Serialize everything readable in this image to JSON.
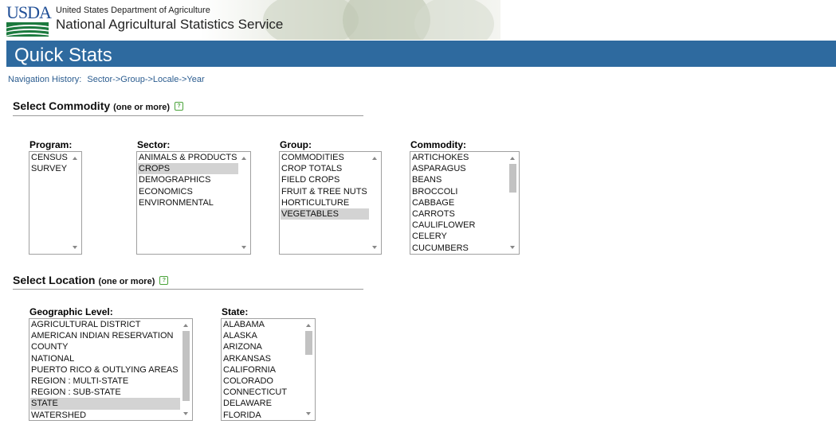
{
  "header": {
    "logo_text": "USDA",
    "org_line1": "United States Department of Agriculture",
    "org_line2": "National Agricultural Statistics Service",
    "page_title": "Quick Stats"
  },
  "nav_history": {
    "label": "Navigation History:",
    "path": "Sector->Group->Locale->Year"
  },
  "commodity_section": {
    "title": "Select Commodity",
    "subtitle": "(one or more)",
    "program": {
      "label": "Program:",
      "options": [
        "CENSUS",
        "SURVEY"
      ],
      "selected": []
    },
    "sector": {
      "label": "Sector:",
      "options": [
        "ANIMALS & PRODUCTS",
        "CROPS",
        "DEMOGRAPHICS",
        "ECONOMICS",
        "ENVIRONMENTAL"
      ],
      "selected": [
        "CROPS"
      ]
    },
    "group": {
      "label": "Group:",
      "options": [
        "COMMODITIES",
        "CROP TOTALS",
        "FIELD CROPS",
        "FRUIT & TREE NUTS",
        "HORTICULTURE",
        "VEGETABLES"
      ],
      "selected": [
        "VEGETABLES"
      ]
    },
    "commodity": {
      "label": "Commodity:",
      "options": [
        "ARTICHOKES",
        "ASPARAGUS",
        "BEANS",
        "BROCCOLI",
        "CABBAGE",
        "CARROTS",
        "CAULIFLOWER",
        "CELERY",
        "CUCUMBERS"
      ],
      "selected": []
    }
  },
  "location_section": {
    "title": "Select Location",
    "subtitle": "(one or more)",
    "geo_level": {
      "label": "Geographic Level:",
      "options": [
        "AGRICULTURAL DISTRICT",
        "AMERICAN INDIAN RESERVATION",
        "COUNTY",
        "NATIONAL",
        "PUERTO RICO & OUTLYING AREAS",
        "REGION : MULTI-STATE",
        "REGION : SUB-STATE",
        "STATE",
        "WATERSHED"
      ],
      "selected": [
        "STATE"
      ]
    },
    "state": {
      "label": "State:",
      "options": [
        "ALABAMA",
        "ALASKA",
        "ARIZONA",
        "ARKANSAS",
        "CALIFORNIA",
        "COLORADO",
        "CONNECTICUT",
        "DELAWARE",
        "FLORIDA"
      ],
      "selected": []
    }
  },
  "colors": {
    "header_bar": "#2e6a9f",
    "logo_blue": "#1f4e96",
    "logo_green": "#1c7a3e",
    "nav_link": "#2b5c8f",
    "selected_bg": "#d3d3d3",
    "help_icon": "#4aa33a"
  }
}
